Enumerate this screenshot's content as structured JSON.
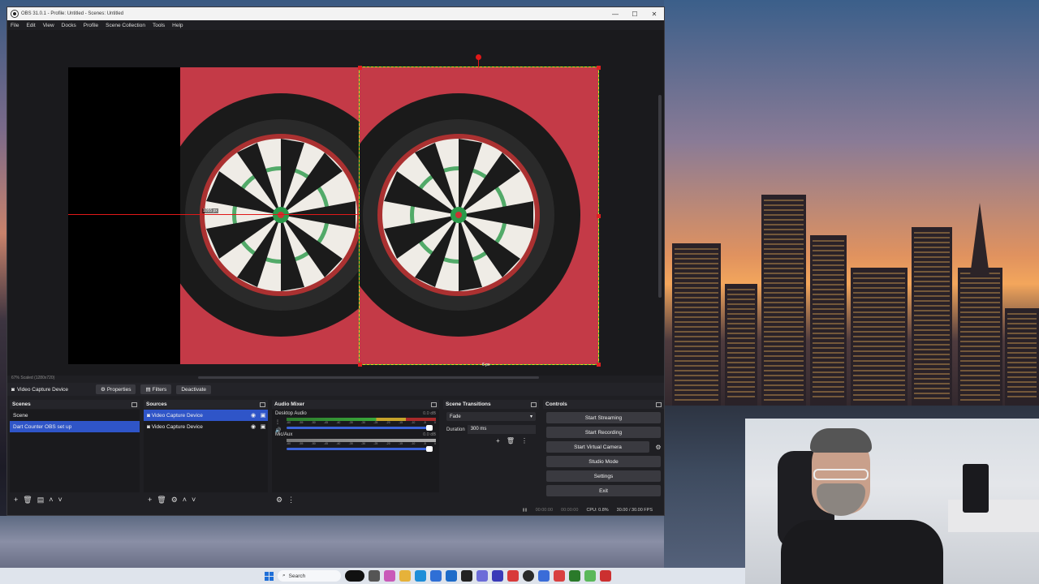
{
  "window": {
    "title": "OBS 31.0.1 - Profile: Untitled - Scenes: Untitled",
    "minimize": "—",
    "maximize": "☐",
    "close": "✕"
  },
  "menu": [
    "File",
    "Edit",
    "View",
    "Docks",
    "Profile",
    "Scene Collection",
    "Tools",
    "Help"
  ],
  "preview": {
    "guide_label": "1055 px",
    "bottom_label": "6 px",
    "zoom_status": "67%   Scaled (1280x720)"
  },
  "source_toolbar": {
    "current_source": "Video Capture Device",
    "properties": "Properties",
    "filters": "Filters",
    "deactivate": "Deactivate"
  },
  "scenes": {
    "title": "Scenes",
    "items": [
      "Scene",
      "Dart Counter OBS set up"
    ],
    "selected_index": 1
  },
  "sources": {
    "title": "Sources",
    "items": [
      "Video Capture Device",
      "Video Capture Device"
    ],
    "selected_index": 0
  },
  "mixer": {
    "title": "Audio Mixer",
    "channels": [
      {
        "name": "Desktop Audio",
        "db": "0.0 dB"
      },
      {
        "name": "Mic/Aux",
        "db": "0.0 dB"
      }
    ],
    "scale": [
      "-60",
      "-55",
      "-50",
      "-45",
      "-40",
      "-35",
      "-30",
      "-25",
      "-20",
      "-15",
      "-10",
      "-5",
      "0"
    ]
  },
  "transitions": {
    "title": "Scene Transitions",
    "selected": "Fade",
    "duration_label": "Duration",
    "duration_value": "300 ms"
  },
  "controls": {
    "title": "Controls",
    "start_streaming": "Start Streaming",
    "start_recording": "Start Recording",
    "start_virtual_camera": "Start Virtual Camera",
    "studio_mode": "Studio Mode",
    "settings": "Settings",
    "exit": "Exit"
  },
  "status": {
    "stream_time": "00:00:00",
    "record_time": "00:00:00",
    "cpu": "CPU: 0.8%",
    "fps": "30.00 / 30.00 FPS"
  },
  "taskbar": {
    "search_placeholder": "Search"
  },
  "icons": {
    "camera": "camera-icon",
    "gear": "gear-icon",
    "eye": "eye-icon",
    "lock": "lock-icon",
    "plus": "plus-icon",
    "trash": "trash-icon"
  }
}
